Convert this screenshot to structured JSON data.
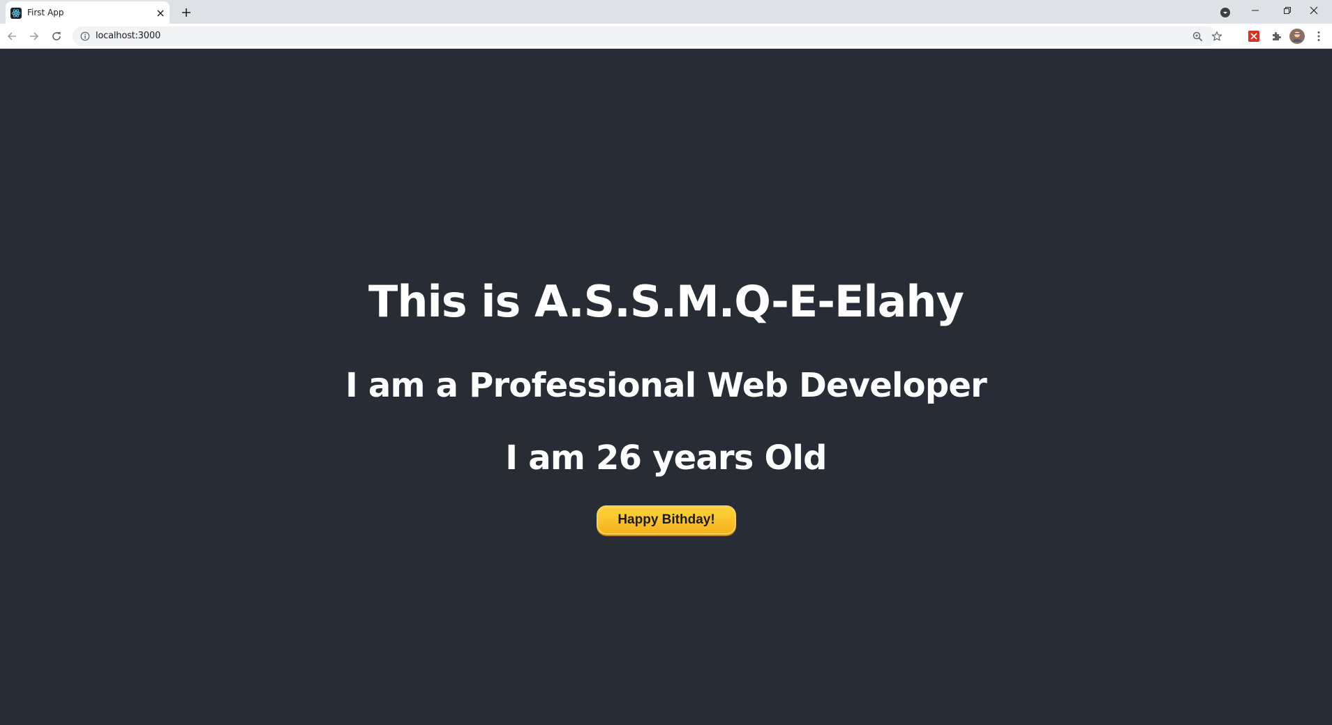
{
  "browser": {
    "tab": {
      "title": "First App"
    },
    "address": {
      "url": "localhost:3000"
    }
  },
  "page": {
    "heading": "This is A.S.S.M.Q-E-Elahy",
    "profession": "I am a Professional Web Developer",
    "age": "I am 26 years Old",
    "button_label": "Happy Bithday!"
  },
  "colors": {
    "page_background": "#282c34",
    "button_background": "#f5b21c",
    "text": "#ffffff"
  },
  "icons": {
    "favicon": "react-icon",
    "tab_close": "close-icon",
    "new_tab": "plus-icon",
    "tab_search": "chevron-down-icon",
    "minimize": "minimize-icon",
    "restore": "restore-icon",
    "close_window": "close-icon",
    "back": "back-arrow-icon",
    "forward": "forward-arrow-icon",
    "reload": "reload-icon",
    "site_info": "info-icon",
    "zoom": "zoom-icon",
    "bookmark": "star-icon",
    "extension_1": "extension-icon",
    "extensions": "puzzle-icon",
    "profile": "avatar",
    "menu": "kebab-menu-icon"
  }
}
